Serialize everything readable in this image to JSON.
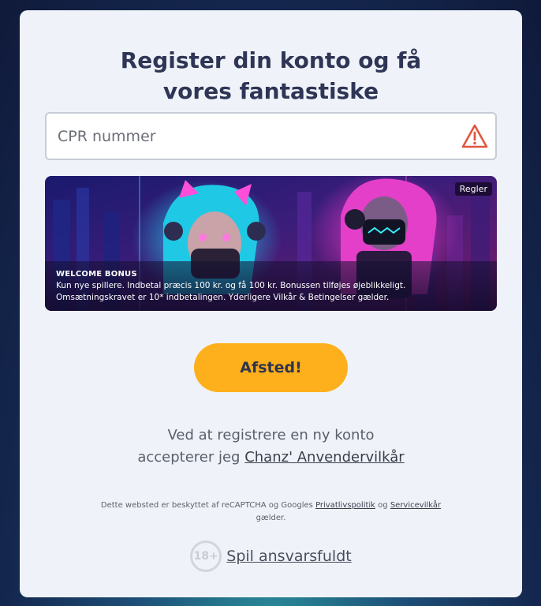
{
  "heading": "Register din konto og få vores fantastiske velkomstpakke!",
  "cpr": {
    "placeholder": "CPR nummer",
    "status_icon": "warning-triangle-icon",
    "status_color": "#e0573e"
  },
  "banner": {
    "rules_label": "Regler",
    "title": "WELCOME BONUS",
    "body": "Kun nye spillere. Indbetal præcis 100 kr. og få 100 kr. Bonussen tilføjes øjeblikkeligt. Omsætningskravet er 10* indbetalingen. Yderligere Vilkår & Betingelser gælder."
  },
  "cta": {
    "label": "Afsted!",
    "color": "#fdb01b"
  },
  "terms": {
    "line1": "Ved at registrere en ny konto",
    "prefix": "accepterer jeg ",
    "link": "Chanz' Anvendervilkår"
  },
  "captcha": {
    "prefix": "Dette websted er beskyttet af reCAPTCHA og Googles ",
    "privacy_link": "Privatlivspolitik",
    "and": " og ",
    "terms_link": "Servicevilkår",
    "suffix": " gælder."
  },
  "responsible": {
    "age_badge": "18+",
    "link": "Spil ansvarsfuldt"
  }
}
